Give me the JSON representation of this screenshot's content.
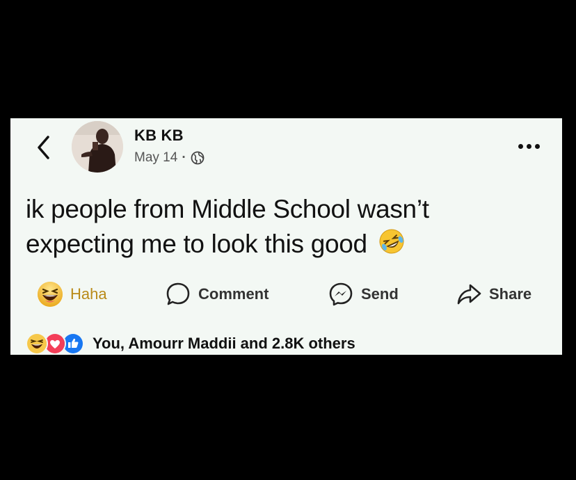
{
  "post": {
    "author_name": "KB KB",
    "date": "May 14",
    "separator": "·",
    "privacy_icon": "globe-icon",
    "text": "ik people from Middle School wasn’t expecting me to look this good",
    "text_emoji": "rolling-on-floor-laughing-emoji"
  },
  "actions": {
    "haha_label": "Haha",
    "comment_label": "Comment",
    "send_label": "Send",
    "share_label": "Share"
  },
  "reactions": {
    "icons": [
      "haha-icon",
      "love-icon",
      "like-icon"
    ],
    "summary": "You, Amourr Maddii and 2.8K others"
  },
  "colors": {
    "background": "#000000",
    "card": "#f3f8f4",
    "haha_label": "#b98a18",
    "like_blue": "#1877f2",
    "love_red": "#f33e58"
  }
}
